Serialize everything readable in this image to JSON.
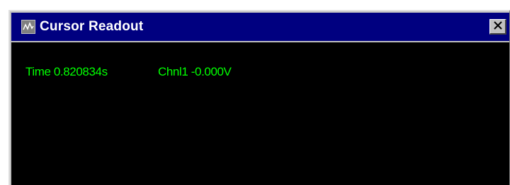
{
  "window": {
    "title": "Cursor Readout",
    "icon": "waveform-icon",
    "close_symbol": "✕"
  },
  "readout": {
    "time_label": "Time",
    "time_value": "0.820834s",
    "channel_label": "Chnl1",
    "channel_value": "-0.000V"
  },
  "colors": {
    "title_bar": "#000080",
    "readout_background": "#000000",
    "readout_text": "#00ff00",
    "window_frame": "#c0c0c0"
  }
}
